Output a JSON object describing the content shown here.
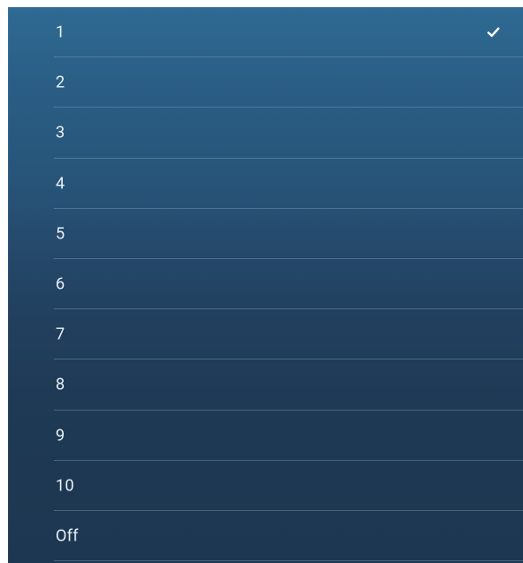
{
  "menu": {
    "options": [
      {
        "label": "1",
        "selected": true
      },
      {
        "label": "2",
        "selected": false
      },
      {
        "label": "3",
        "selected": false
      },
      {
        "label": "4",
        "selected": false
      },
      {
        "label": "5",
        "selected": false
      },
      {
        "label": "6",
        "selected": false
      },
      {
        "label": "7",
        "selected": false
      },
      {
        "label": "8",
        "selected": false
      },
      {
        "label": "9",
        "selected": false
      },
      {
        "label": "10",
        "selected": false
      },
      {
        "label": "Off",
        "selected": false
      }
    ],
    "check_icon": "checkmark-icon",
    "colors": {
      "background_top": "#2e6a93",
      "background_bottom": "#1d3651",
      "text": "#e8f0f6",
      "divider": "#8fb0c8"
    }
  }
}
